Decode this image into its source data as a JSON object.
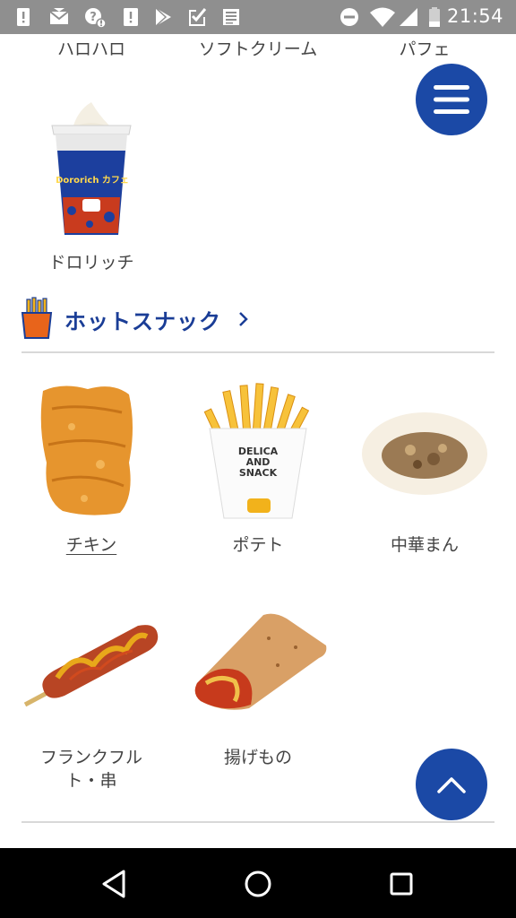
{
  "status_bar": {
    "time": "21:54",
    "icons": [
      "alert-icon",
      "mail-icon",
      "alert-badge-icon",
      "alert-icon",
      "play-store-icon",
      "checklist-icon",
      "news-icon",
      "dnd-icon",
      "wifi-icon",
      "signal-icon",
      "battery-icon"
    ]
  },
  "top_row": [
    "ハロハロ",
    "ソフトクリーム",
    "パフェ"
  ],
  "dessert_items": [
    {
      "label": "ドロリッチ",
      "image_text": "Dororich カフェ"
    }
  ],
  "section": {
    "title": "ホットスナック",
    "icon": "fries-icon",
    "chevron": "chevron-right-icon"
  },
  "hot_snacks": [
    {
      "label": "チキン"
    },
    {
      "label": "ポテト",
      "image_text": "DELICA AND SNACK"
    },
    {
      "label": "中華まん"
    },
    {
      "label": "フランクフルト・串",
      "label_line1": "フランクフル",
      "label_line2": "ト・串"
    },
    {
      "label": "揚げもの"
    }
  ],
  "buttons": {
    "menu": "menu-icon",
    "scroll_top": "chevron-up-icon"
  },
  "colors": {
    "accent": "#1b49a6",
    "section_title": "#1a3d96",
    "status_bar": "#8f8f8f"
  },
  "nav": [
    "back-icon",
    "home-icon",
    "recents-icon"
  ]
}
